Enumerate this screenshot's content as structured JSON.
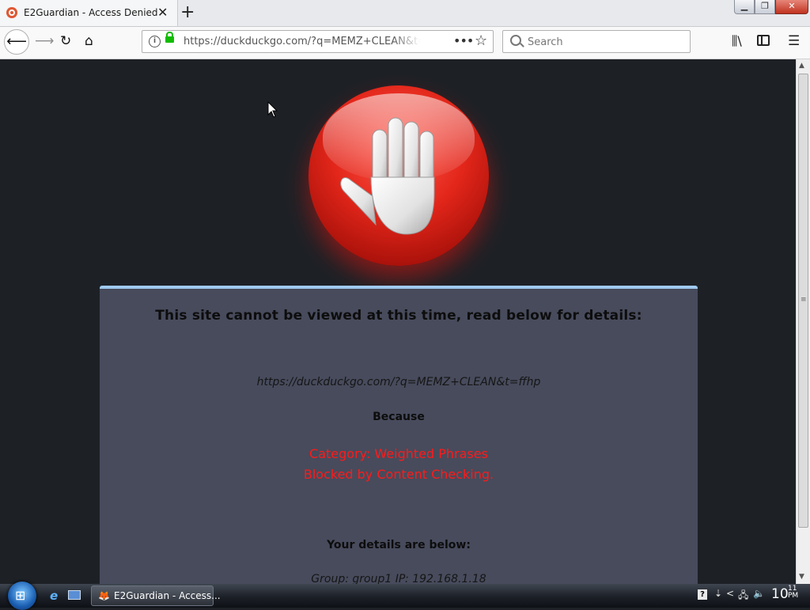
{
  "tab": {
    "title": "E2Guardian - Access Denied",
    "close": "✕",
    "new_tab": "+"
  },
  "window_controls": {
    "minimize": "▁",
    "maximize": "❐",
    "close": "✕"
  },
  "nav": {
    "back": "⟵",
    "forward": "⟶",
    "reload": "↻",
    "home": "⌂",
    "url": "https://duckduckgo.com/?q=MEMZ+CLEAN&t=f",
    "page_actions": "•••",
    "bookmark": "☆",
    "search_placeholder": "Search",
    "library": "⫼\\",
    "menu": "☰"
  },
  "page": {
    "headline": "This site cannot be viewed at this time, read below for details:",
    "blocked_url": "https://duckduckgo.com/?q=MEMZ+CLEAN&t=ffhp",
    "because": "Because",
    "category": "Category: Weighted Phrases",
    "reason": "Blocked by Content Checking.",
    "details_heading": "Your details are below:",
    "details": "Group: group1   IP: 192.168.1.18"
  },
  "scrollbar": {
    "up": "▲",
    "grip": "≡",
    "down": "▼"
  },
  "taskbar": {
    "start_glyph": "⊞",
    "ie_glyph": "e",
    "task_label": "E2Guardian - Access...",
    "task_icon": "🦊",
    "tray_help": "?",
    "tray_arrow": "⇣",
    "tray_chevron": "<",
    "tray_network": "🖧",
    "tray_volume": "🔈",
    "clock_hour": "10",
    "clock_min": "11",
    "clock_ampm": "PM"
  },
  "colors": {
    "page_background": "#1d2126",
    "panel_background": "#474b5c",
    "panel_accent": "#9fc9f0",
    "reason_text": "#ff1a1a",
    "stop_sign_red": "#e3261a"
  }
}
